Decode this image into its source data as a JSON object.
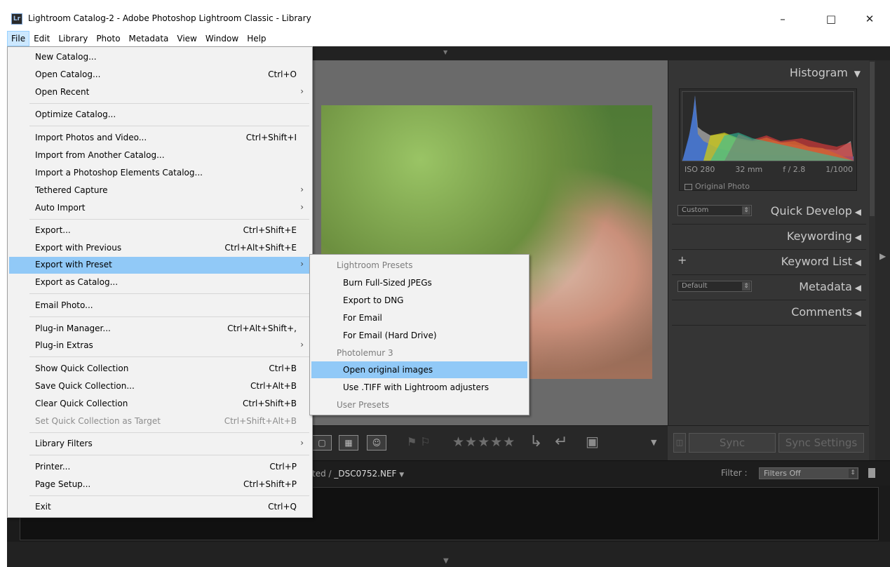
{
  "window": {
    "app_badge": "Lr",
    "title": "Lightroom Catalog-2 - Adobe Photoshop Lightroom Classic - Library",
    "minimize": "–",
    "maximize": "□",
    "close": "✕"
  },
  "menubar": [
    "File",
    "Edit",
    "Library",
    "Photo",
    "Metadata",
    "View",
    "Window",
    "Help"
  ],
  "file_menu": {
    "items": [
      {
        "label": "New Catalog...",
        "shortcut": ""
      },
      {
        "label": "Open Catalog...",
        "shortcut": "Ctrl+O"
      },
      {
        "label": "Open Recent",
        "shortcut": ""
      },
      {
        "label": "Optimize Catalog...",
        "shortcut": ""
      },
      {
        "label": "Import Photos and Video...",
        "shortcut": "Ctrl+Shift+I"
      },
      {
        "label": "Import from Another Catalog...",
        "shortcut": ""
      },
      {
        "label": "Import a Photoshop Elements Catalog...",
        "shortcut": ""
      },
      {
        "label": "Tethered Capture",
        "shortcut": ""
      },
      {
        "label": "Auto Import",
        "shortcut": ""
      },
      {
        "label": "Export...",
        "shortcut": "Ctrl+Shift+E"
      },
      {
        "label": "Export with Previous",
        "shortcut": "Ctrl+Alt+Shift+E"
      },
      {
        "label": "Export with Preset",
        "shortcut": ""
      },
      {
        "label": "Export as Catalog...",
        "shortcut": ""
      },
      {
        "label": "Email Photo...",
        "shortcut": ""
      },
      {
        "label": "Plug-in Manager...",
        "shortcut": "Ctrl+Alt+Shift+,"
      },
      {
        "label": "Plug-in Extras",
        "shortcut": ""
      },
      {
        "label": "Show Quick Collection",
        "shortcut": "Ctrl+B"
      },
      {
        "label": "Save Quick Collection...",
        "shortcut": "Ctrl+Alt+B"
      },
      {
        "label": "Clear Quick Collection",
        "shortcut": "Ctrl+Shift+B"
      },
      {
        "label": "Set Quick Collection as Target",
        "shortcut": "Ctrl+Shift+Alt+B"
      },
      {
        "label": "Library Filters",
        "shortcut": ""
      },
      {
        "label": "Printer...",
        "shortcut": "Ctrl+P"
      },
      {
        "label": "Page Setup...",
        "shortcut": "Ctrl+Shift+P"
      },
      {
        "label": "Exit",
        "shortcut": "Ctrl+Q"
      }
    ]
  },
  "export_preset_submenu": {
    "items": [
      {
        "label": "Lightroom Presets"
      },
      {
        "label": "Burn Full-Sized JPEGs"
      },
      {
        "label": "Export to DNG"
      },
      {
        "label": "For Email"
      },
      {
        "label": "For Email (Hard Drive)"
      },
      {
        "label": "Photolemur 3"
      },
      {
        "label": "Open original images"
      },
      {
        "label": "Use .TIFF with Lightroom adjusters"
      },
      {
        "label": "User Presets"
      }
    ]
  },
  "right_panel": {
    "histogram_title": "Histogram",
    "exif": {
      "iso": "ISO 280",
      "focal": "32 mm",
      "aperture": "f / 2.8",
      "shutter": "1/1000"
    },
    "original_photo": "Original Photo",
    "quick_develop": {
      "title": "Quick Develop",
      "preset": "Custom"
    },
    "keywording": "Keywording",
    "keyword_list": "Keyword List",
    "metadata": {
      "title": "Metadata",
      "preset": "Default"
    },
    "comments": "Comments",
    "sync": "Sync",
    "sync_settings": "Sync Settings"
  },
  "filmstrip": {
    "path_prefix": "ted /",
    "filename": "_DSC0752.NEF",
    "filter_label": "Filter :",
    "filter_value": "Filters Off"
  },
  "colors": {
    "menu_highlight": "#91c9f7",
    "menubar_active": "#cce8ff",
    "dark_panel": "#353535"
  },
  "icons": [
    "lightroom-icon",
    "minimize-icon",
    "maximize-icon",
    "close-icon",
    "submenu-arrow-icon",
    "panel-collapse-icon",
    "flag-icon",
    "star-icon",
    "rotate-icon",
    "compare-icon",
    "lock-icon"
  ]
}
